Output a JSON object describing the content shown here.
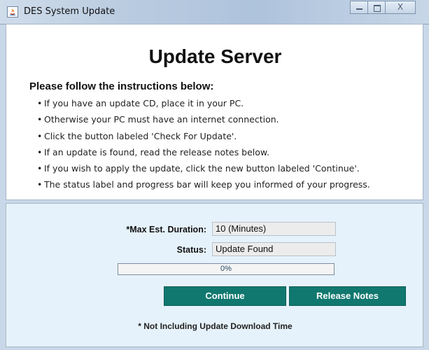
{
  "window": {
    "title": "DES System Update",
    "controls": {
      "minimize": "minimize",
      "maximize": "maximize",
      "close": "X"
    }
  },
  "top": {
    "heading": "Update Server",
    "instructions_title": "Please follow the instructions below:",
    "instructions": [
      "If you have an update CD, place it in your PC.",
      "Otherwise your PC must have an internet connection.",
      "Click the button labeled 'Check For Update'.",
      "If an update is found, read the release notes below.",
      "If you wish to apply the update, click the new button labeled 'Continue'.",
      "The status label and progress bar will keep you informed of your progress."
    ]
  },
  "bottom": {
    "duration_label": "*Max Est. Duration:",
    "duration_value": "10 (Minutes)",
    "status_label": "Status:",
    "status_value": "Update Found",
    "progress_percent": 0,
    "progress_text": "0%",
    "continue_label": "Continue",
    "release_notes_label": "Release Notes",
    "footnote": "* Not Including Update Download Time"
  },
  "colors": {
    "button_bg": "#10786f",
    "bottom_panel_bg": "#e6f2fb"
  }
}
